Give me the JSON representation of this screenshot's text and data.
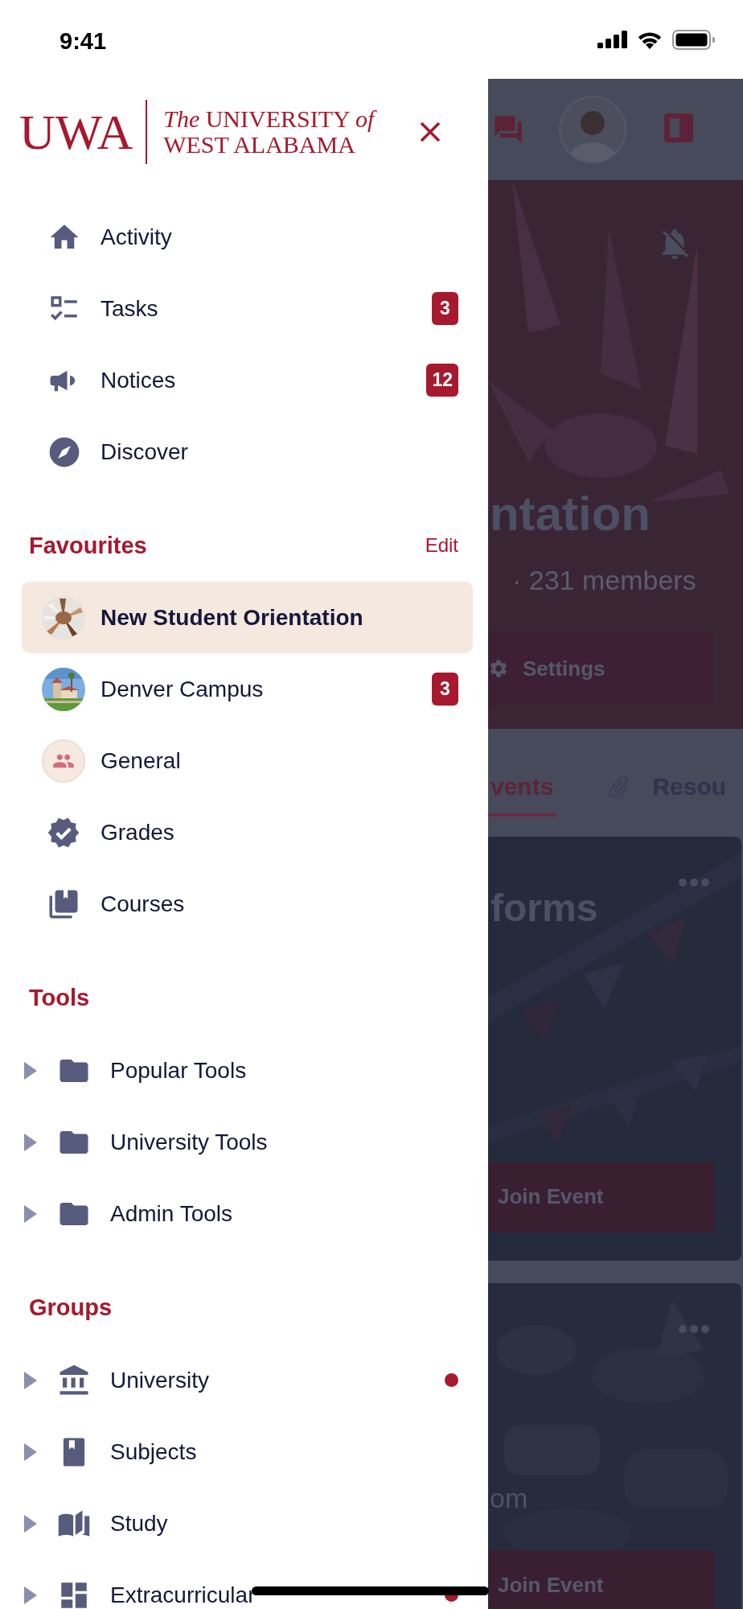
{
  "status_bar": {
    "time": "9:41"
  },
  "drawer": {
    "logo": {
      "mark": "UWA",
      "line_1": "*The* UNIVERSITY *of*",
      "line_2": "WEST ALABAMA"
    },
    "nav": [
      {
        "label": "Activity"
      },
      {
        "label": "Tasks",
        "badge": "3"
      },
      {
        "label": "Notices",
        "badge": "12"
      },
      {
        "label": "Discover"
      }
    ],
    "favourites": {
      "title": "Favourites",
      "action": "Edit",
      "items": [
        {
          "label": "New Student Orientation",
          "kind": "picture",
          "selected": true
        },
        {
          "label": "Denver Campus",
          "kind": "picture",
          "selected": false,
          "badge": "3"
        },
        {
          "label": "General",
          "kind": "avatar",
          "selected": false
        },
        {
          "label": "Grades",
          "kind": "icon",
          "selected": false
        },
        {
          "label": "Courses",
          "kind": "icon",
          "selected": false
        }
      ]
    },
    "tools": {
      "title": "Tools",
      "items": [
        {
          "label": "Popular Tools",
          "expanded": false
        },
        {
          "label": "University Tools",
          "expanded": false
        },
        {
          "label": "Admin Tools",
          "expanded": false
        }
      ]
    },
    "groups": {
      "title": "Groups",
      "items": [
        {
          "label": "University",
          "expanded": false,
          "unread": true
        },
        {
          "label": "Subjects",
          "expanded": false,
          "unread": false
        },
        {
          "label": "Study",
          "expanded": false,
          "unread": false
        },
        {
          "label": "Extracurricular",
          "expanded": false,
          "unread": true
        }
      ]
    }
  },
  "background": {
    "hero": {
      "title": "ntation",
      "meta": "· 231 members",
      "settings_button": "Settings"
    },
    "tabs": [
      {
        "label": "vents",
        "selected": true
      },
      {
        "label": "Resou",
        "selected": false
      }
    ],
    "cards": [
      {
        "title": "forms",
        "button": "Join Event"
      },
      {
        "subtitle": "om",
        "button": "Join Event"
      }
    ]
  }
}
